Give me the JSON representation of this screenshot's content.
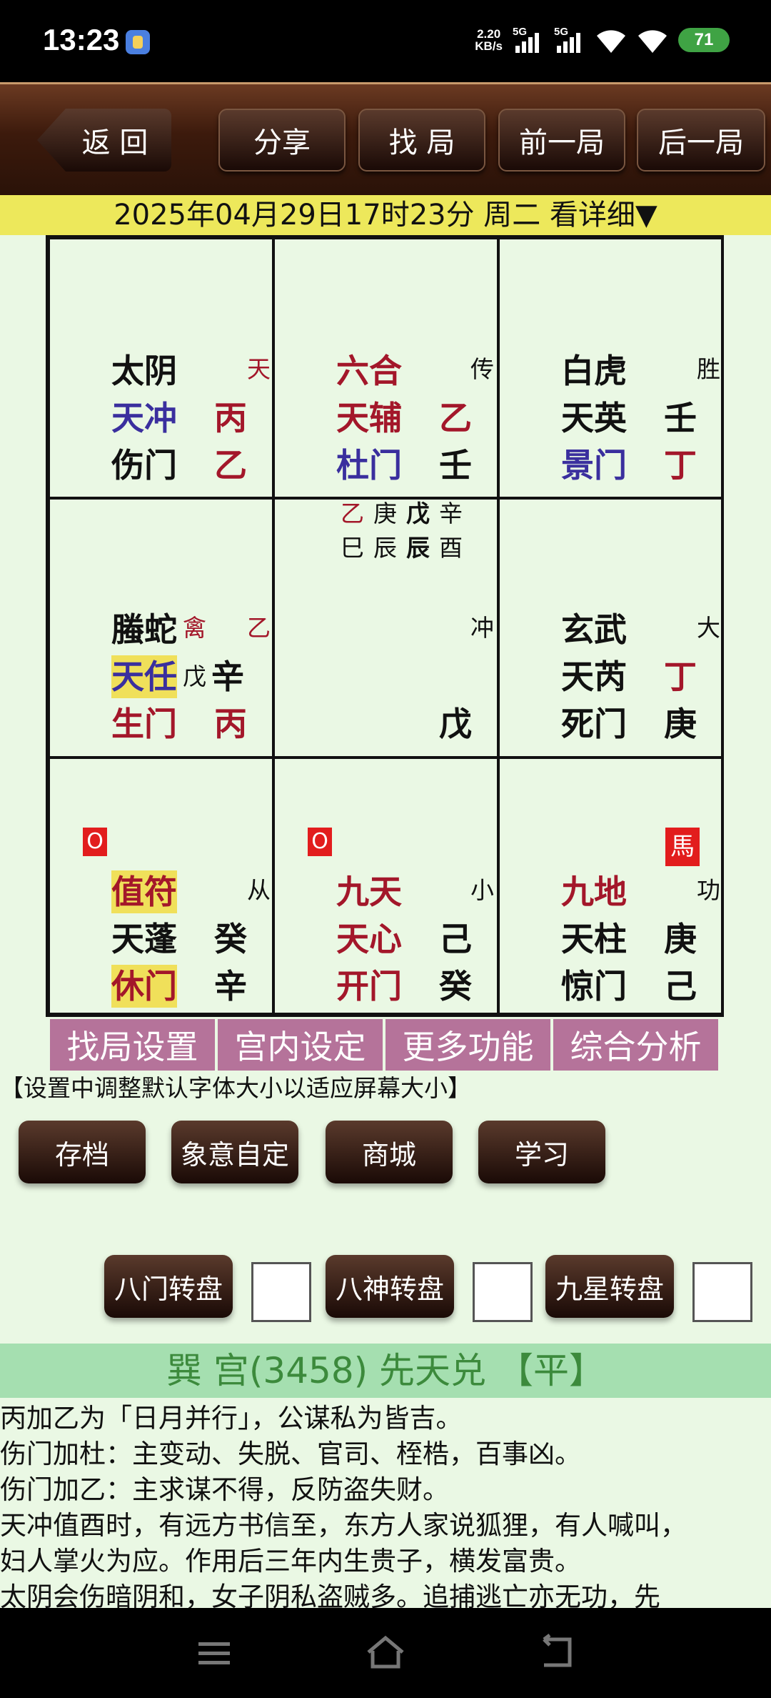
{
  "status": {
    "time": "13:23",
    "speed_value": "2.20",
    "speed_unit": "KB/s",
    "sig1": "5G",
    "sig2": "5G",
    "battery": "71"
  },
  "toolbar": {
    "back": "返 回",
    "share": "分享",
    "find": "找 局",
    "prev": "前一局",
    "next": "后一局"
  },
  "date_line": "2025年04月29日17时23分 周二 看详细▼",
  "grid": {
    "c1": {
      "small": "天",
      "r1": "太阴",
      "r2a": "天冲",
      "r2b": "丙",
      "r3a": "伤门",
      "r3b": "乙"
    },
    "c2": {
      "small": "传",
      "r1": "六合",
      "r2a": "天辅",
      "r2b": "乙",
      "r3a": "杜门",
      "r3b": "壬"
    },
    "c3": {
      "small": "胜",
      "r1": "白虎",
      "r2a": "天英",
      "r2b": "壬",
      "r3a": "景门",
      "r3b": "丁"
    },
    "c4": {
      "small1": "禽",
      "small2": "乙",
      "r1": "螣蛇",
      "r2a": "天任",
      "r2m": "戊",
      "r2b": "辛",
      "r3a": "生门",
      "r3b": "丙"
    },
    "c5": {
      "top1a": "乙",
      "top1b": "庚",
      "top1c": "戊",
      "top1d": "辛",
      "top2a": "巳",
      "top2b": "辰",
      "top2c": "辰",
      "top2d": "酉",
      "small": "冲",
      "r3b": "戊"
    },
    "c6": {
      "small": "大",
      "r1": "玄武",
      "r2a": "天芮",
      "r2b": "丁",
      "r3a": "死门",
      "r3b": "庚"
    },
    "c7": {
      "badge": "O",
      "small": "从",
      "r1": "值符",
      "r2a": "天蓬",
      "r2b": "癸",
      "r3a": "休门",
      "r3b": "辛"
    },
    "c8": {
      "badge": "O",
      "small": "小",
      "r1": "九天",
      "r2a": "天心",
      "r2b": "己",
      "r3a": "开门",
      "r3b": "癸"
    },
    "c9": {
      "badge": "馬",
      "small": "功",
      "r1": "九地",
      "r2a": "天柱",
      "r2b": "庚",
      "r3a": "惊门",
      "r3b": "己"
    }
  },
  "tabs": [
    "找局设置",
    "宫内设定",
    "更多功能",
    "综合分析"
  ],
  "hint": "【设置中调整默认字体大小以适应屏幕大小】",
  "actions": [
    "存档",
    "象意自定",
    "商城",
    "学习"
  ],
  "rotate": [
    "八门转盘",
    "八神转盘",
    "九星转盘"
  ],
  "palace_title": "巽 宫(3458) 先天兑 【平】",
  "text_lines": [
    "丙加乙为「日月并行」，公谋私为皆吉。",
    "伤门加杜：主变动、失脱、官司、桎梏，百事凶。",
    "伤门加乙：主求谋不得，反防盗失财。",
    "天冲值酉时，有远方书信至，东方人家说狐狸，有人喊叫，",
    "妇人掌火为应。作用后三年内生贵子，横发富贵。",
    "太阴会伤暗阴和，女子阴私盗贼多。追捕逃亡亦无功，先"
  ]
}
